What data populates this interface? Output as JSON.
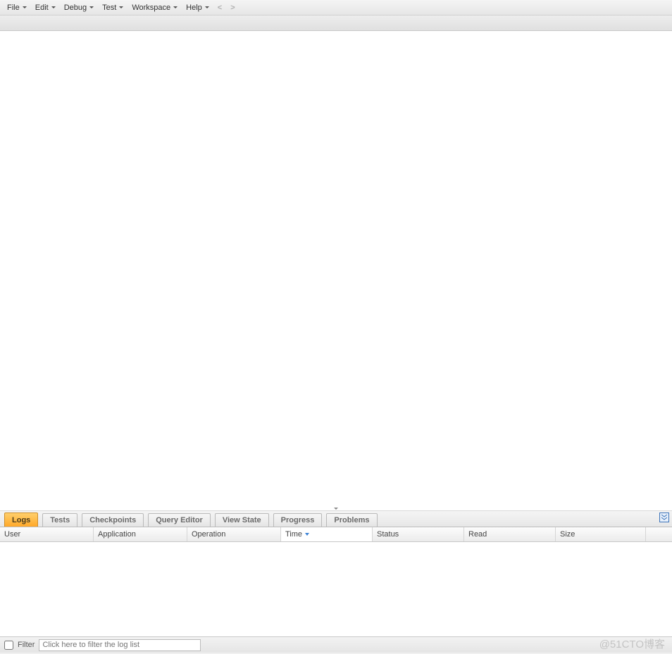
{
  "menu": {
    "items": [
      "File",
      "Edit",
      "Debug",
      "Test",
      "Workspace",
      "Help"
    ]
  },
  "nav": {
    "back": "<",
    "forward": ">"
  },
  "panel": {
    "tabs": [
      "Logs",
      "Tests",
      "Checkpoints",
      "Query Editor",
      "View State",
      "Progress",
      "Problems"
    ],
    "active": 0
  },
  "grid": {
    "columns": [
      {
        "label": "User",
        "width": 133
      },
      {
        "label": "Application",
        "width": 133
      },
      {
        "label": "Operation",
        "width": 133
      },
      {
        "label": "Time",
        "width": 130,
        "sorted": true
      },
      {
        "label": "Status",
        "width": 130
      },
      {
        "label": "Read",
        "width": 130
      },
      {
        "label": "Size",
        "width": 128
      }
    ]
  },
  "filter": {
    "label": "Filter",
    "placeholder": "Click here to filter the log list"
  },
  "watermark": "@51CTO博客"
}
